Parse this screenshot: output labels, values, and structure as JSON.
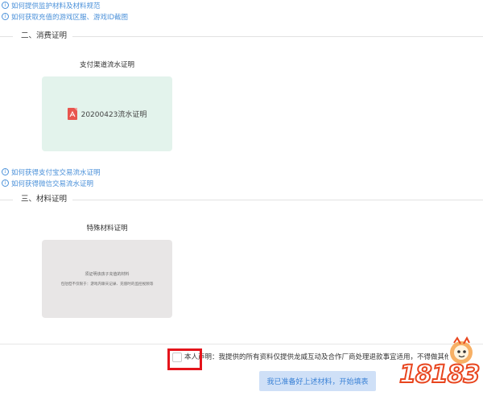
{
  "help_links_top": [
    {
      "label": "如何提供监护材料及材料规范"
    },
    {
      "label": "如何获取充值的游戏区服、游戏ID截图"
    }
  ],
  "section_consumption": {
    "title": "二、消费证明",
    "card_title": "支付渠道流水证明",
    "file_name": "20200423流水证明",
    "file_icon": "pdf-icon"
  },
  "help_links_middle": [
    {
      "label": "如何获得支付宝交易流水证明"
    },
    {
      "label": "如何获得微信交易流水证明"
    }
  ],
  "section_materials": {
    "title": "三、材料证明",
    "card_title": "特殊材料证明",
    "placeholder_line1": "须证明该孩子充值的材料",
    "placeholder_line2": "包括但不仅限于：游戏内聊天记录、充值时的监控视频等"
  },
  "footer": {
    "declaration": "本人声明：我提供的所有资料仅提供龙威互动及合作厂商处理退款事宜适用，不得做其他用途",
    "start_button": "我已准备好上述材料，开始填表",
    "checkbox_checked": false
  },
  "watermark": {
    "text": "18183"
  },
  "colors": {
    "link": "#4a90d9",
    "green_card": "#e3f3ec",
    "gray_card": "#e8e6e6",
    "button_bg": "#cfe0f7",
    "button_text": "#3b82d6",
    "highlight": "#e4141b",
    "pdf": "#e8554e"
  }
}
